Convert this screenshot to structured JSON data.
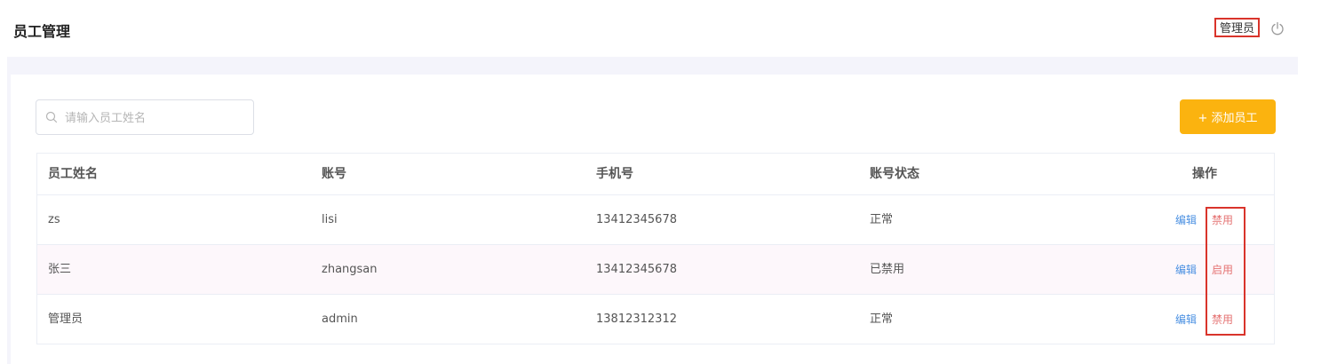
{
  "header": {
    "title": "员工管理",
    "user": "管理员",
    "logout_icon": "power-icon"
  },
  "toolbar": {
    "search_placeholder": "请输入员工姓名",
    "search_value": "",
    "add_button_label": "+ 添加员工",
    "add_button_color": "#fbb30f"
  },
  "table": {
    "columns": [
      "员工姓名",
      "账号",
      "手机号",
      "账号状态",
      "操作"
    ],
    "rows": [
      {
        "name": "zs",
        "account": "lisi",
        "phone": "13412345678",
        "status": "正常",
        "edit": "编辑",
        "toggle": "禁用"
      },
      {
        "name": "张三",
        "account": "zhangsan",
        "phone": "13412345678",
        "status": "已禁用",
        "edit": "编辑",
        "toggle": "启用"
      },
      {
        "name": "管理员",
        "account": "admin",
        "phone": "13812312312",
        "status": "正常",
        "edit": "编辑",
        "toggle": "禁用"
      }
    ]
  },
  "colors": {
    "accent": "#fbb30f",
    "link": "#4a90e2",
    "danger_link": "#e57373",
    "annotation": "#d9342b"
  }
}
